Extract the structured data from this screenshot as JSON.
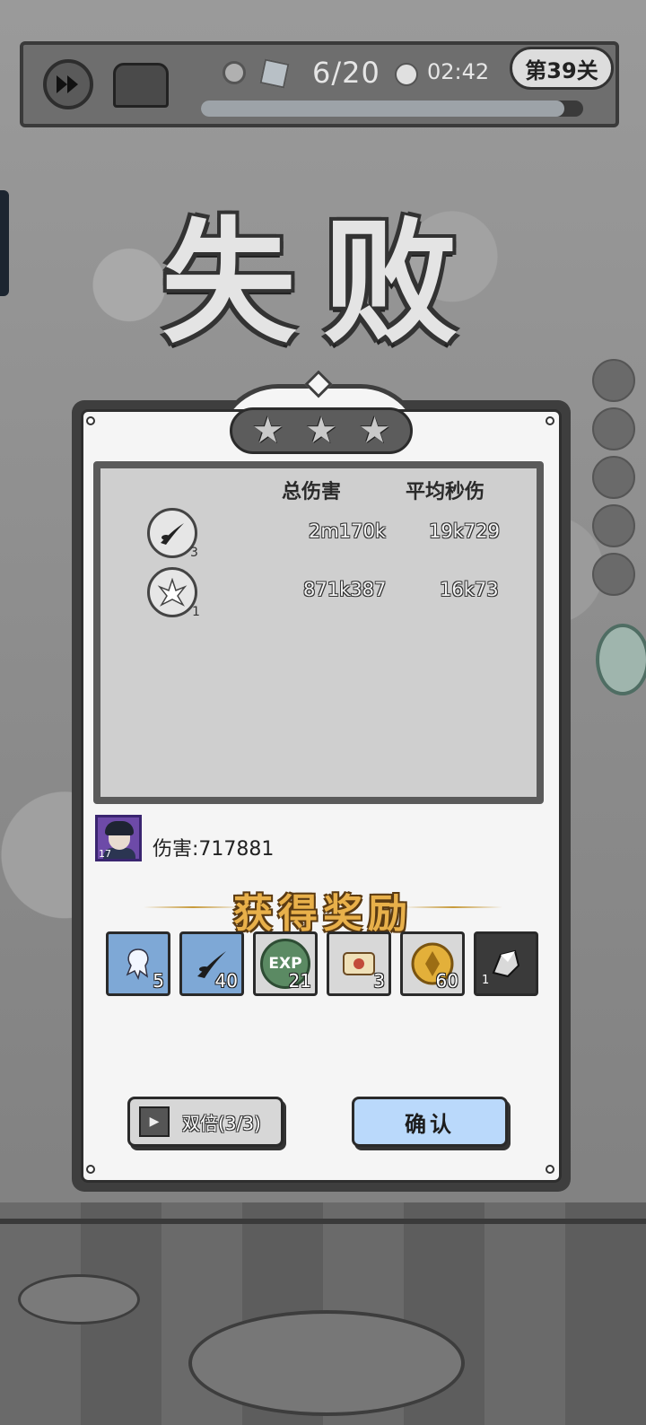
{
  "hud": {
    "wave": "6/20",
    "timer": "02:42",
    "level": "第39关",
    "progress": 0.95
  },
  "result_title": "失败",
  "stars": 3,
  "stats": {
    "headers": {
      "total_damage": "总伤害",
      "dps": "平均秒伤"
    },
    "rows": [
      {
        "icon": "dark-slash-icon",
        "level": "3",
        "total": "2m170k",
        "dps": "19k729"
      },
      {
        "icon": "ice-crystal-icon",
        "level": "1",
        "total": "871k387",
        "dps": "16k73"
      }
    ]
  },
  "hero": {
    "level": "17",
    "damage_text": "伤害:717881"
  },
  "rewards": {
    "title": "获得奖励",
    "items": [
      {
        "icon": "ice-spirit-card-icon",
        "count": "5"
      },
      {
        "icon": "dark-slash-card-icon",
        "count": "40"
      },
      {
        "icon": "exp-icon",
        "label": "EXP",
        "count": "21"
      },
      {
        "icon": "scroll-icon",
        "count": "3"
      },
      {
        "icon": "gold-coin-icon",
        "count": "60"
      },
      {
        "icon": "ore-icon",
        "count": "1"
      }
    ]
  },
  "buttons": {
    "double": "双倍(3/3)",
    "confirm": "确认"
  },
  "colors": {
    "confirm": "#bad9fb",
    "reward_title": "#e8b04a",
    "hero_frame": "#6d4aa8"
  }
}
